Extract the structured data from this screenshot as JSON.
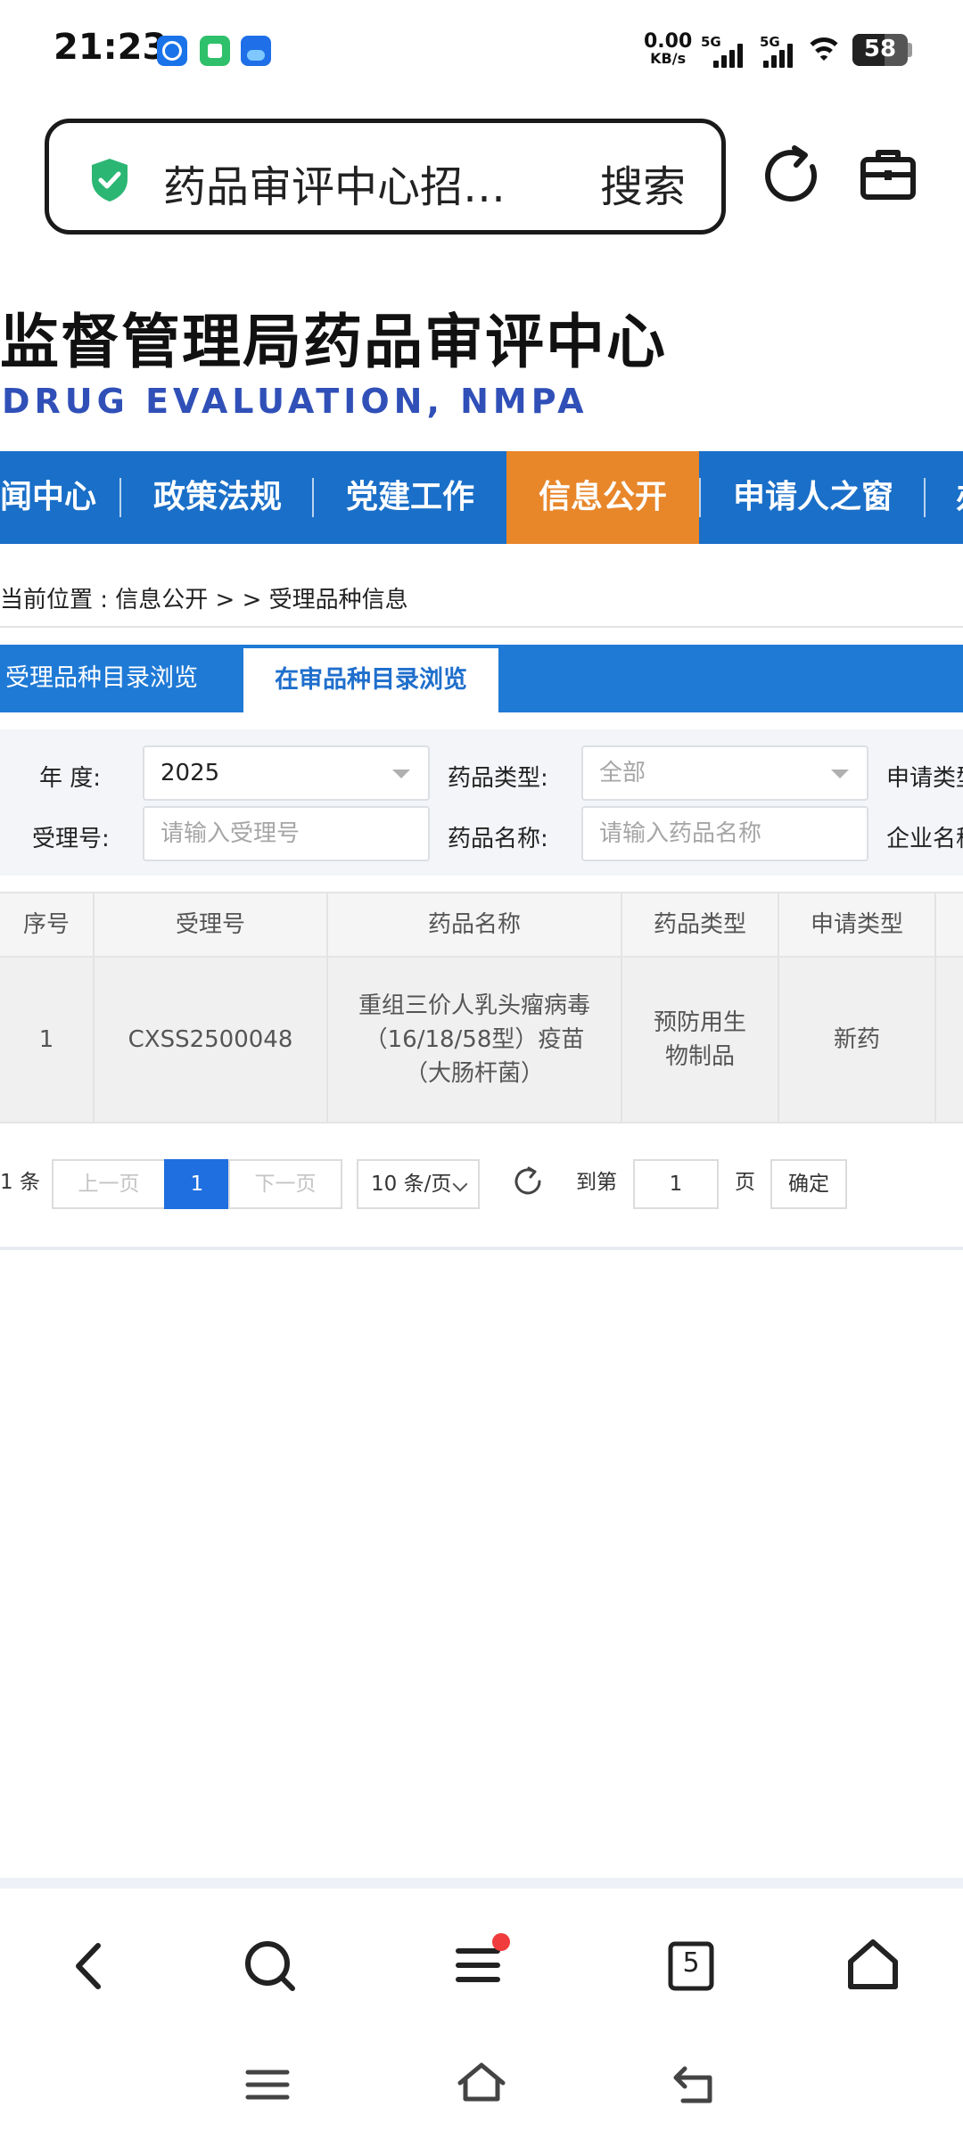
{
  "status_bar": {
    "time": "21:23",
    "net_speed_value": "0.00",
    "net_speed_unit": "KB/s",
    "sim1_label": "5G",
    "sim2_label": "5G",
    "battery": "58",
    "battery_level": 0.58,
    "app_icons": [
      "k-app-icon",
      "mi-app-icon",
      "autohome-app-icon"
    ]
  },
  "browser": {
    "url_text": "药品审评中心招…",
    "search_label": "搜索"
  },
  "site": {
    "title": "监督管理局药品审评中心",
    "subtitle": "DRUG EVALUATION, NMPA"
  },
  "nav": {
    "items": [
      {
        "label": "闻中心"
      },
      {
        "label": "政策法规"
      },
      {
        "label": "党建工作"
      },
      {
        "label": "信息公开"
      },
      {
        "label": "申请人之窗"
      },
      {
        "label": "办"
      }
    ],
    "active_index": 3
  },
  "breadcrumb": "当前位置 : 信息公开 > > 受理品种信息",
  "tabs": [
    {
      "label": "受理品种目录浏览"
    },
    {
      "label": "在审品种目录浏览"
    }
  ],
  "filter": {
    "year_label": "年  度:",
    "year_value": "2025",
    "drug_type_label": "药品类型:",
    "drug_type_value": "全部",
    "apply_type_label": "申请类型",
    "accept_no_label": "受理号:",
    "accept_no_placeholder": "请输入受理号",
    "drug_name_label": "药品名称:",
    "drug_name_placeholder": "请输入药品名称",
    "company_label": "企业名称"
  },
  "table": {
    "headers": [
      "序号",
      "受理号",
      "药品名称",
      "药品类型",
      "申请类型"
    ],
    "rows": [
      {
        "no": "1",
        "accept_no": "CXSS2500048",
        "drug_name": "重组三价人乳头瘤病毒（16/18/58型）疫苗（大肠杆菌）",
        "drug_type": "预防用生物制品",
        "apply_type": "新药"
      }
    ]
  },
  "pager": {
    "total": "1 条",
    "prev": "上一页",
    "current": "1",
    "next": "下一页",
    "page_size": "10 条/页",
    "goto_label": "到第",
    "goto_value": "1",
    "page_unit": "页",
    "confirm": "确定"
  },
  "bottom_nav": {
    "tab_count": "5"
  },
  "colors": {
    "nav_blue": "#1a6fc8",
    "nav_active": "#e8862a",
    "subtitle": "#3050b8",
    "shield_green": "#2bb673",
    "notify_red": "#f03c3c",
    "pager_active": "#1f6fe0"
  }
}
